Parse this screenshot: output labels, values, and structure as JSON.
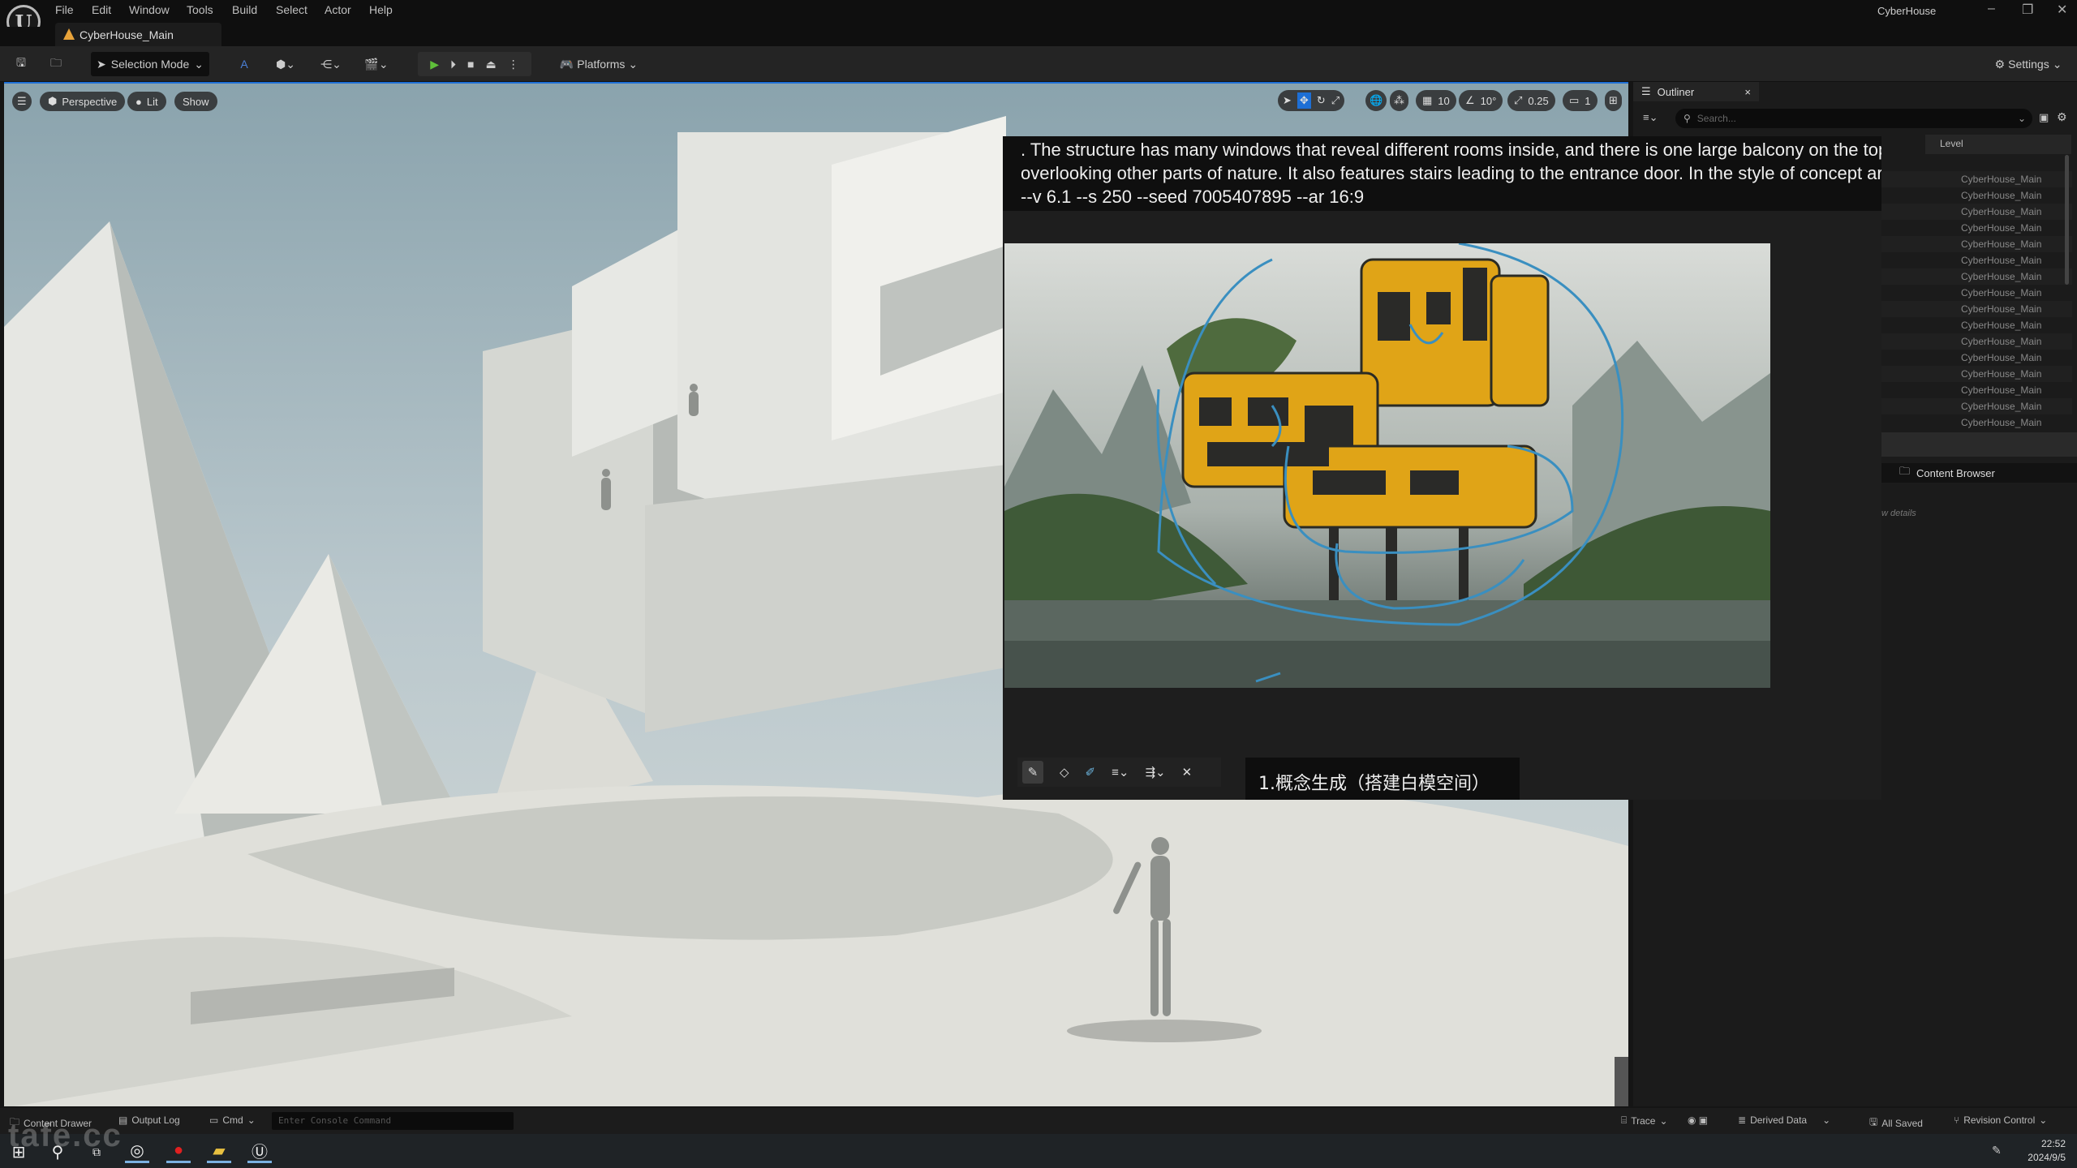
{
  "app": {
    "title": "CyberHouse",
    "document_tab": "CyberHouse_Main",
    "logo": "unreal-engine-logo"
  },
  "menu": [
    "File",
    "Edit",
    "Window",
    "Tools",
    "Build",
    "Select",
    "Actor",
    "Help"
  ],
  "toolbar": {
    "selection_mode": "Selection Mode",
    "platforms": "Platforms",
    "settings": "Settings",
    "play_color": "#5fbf3a"
  },
  "viewport": {
    "perspective": "Perspective",
    "lit": "Lit",
    "show": "Show",
    "grid_snap": "10",
    "rotation_snap": "10°",
    "scale_snap": "0.25",
    "camera_speed": "1",
    "accent": "#1d6fd6"
  },
  "overlay": {
    "prompt_lines": [
      ". The structure has many windows that reveal different rooms inside, and there is one large balcony on the top",
      "overlooking other parts of nature. It also features stairs leading to the entrance door. In the style of concept ar",
      "--v 6.1  --s 250 --seed 7005407895 --ar 16:9"
    ],
    "caption": "1.概念生成（搭建白模空间）",
    "tools": [
      "pen-icon",
      "eraser-icon",
      "highlighter-icon",
      "line-weight-icon",
      "line-style-icon",
      "close-icon"
    ],
    "sketch_color": "#3a8fc0"
  },
  "outliner": {
    "tab": "Outliner",
    "search_placeholder": "Search...",
    "level_header": "Level",
    "rows": [
      "CyberHouse_Main",
      "CyberHouse_Main",
      "CyberHouse_Main",
      "CyberHouse_Main",
      "CyberHouse_Main",
      "CyberHouse_Main",
      "CyberHouse_Main",
      "CyberHouse_Main",
      "CyberHouse_Main",
      "CyberHouse_Main",
      "CyberHouse_Main",
      "CyberHouse_Main",
      "CyberHouse_Main",
      "CyberHouse_Main",
      "CyberHouse_Main",
      "CyberHouse_Main"
    ],
    "content_browser": "Content Browser",
    "details_hint": "w details"
  },
  "status": {
    "content_drawer": "Content Drawer",
    "output_log": "Output Log",
    "cmd": "Cmd",
    "console_placeholder": "Enter Console Command",
    "trace": "Trace",
    "derived_data": "Derived Data",
    "all_saved": "All Saved",
    "revision_control": "Revision Control"
  },
  "taskbar": {
    "time": "22:52",
    "date": "2024/9/5",
    "watermark": "tafe.cc"
  }
}
